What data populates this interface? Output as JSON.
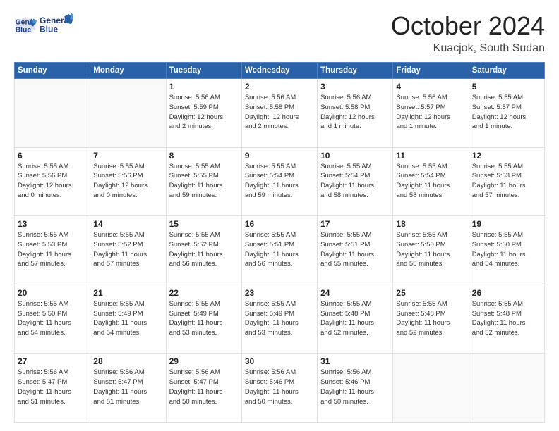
{
  "header": {
    "logo_line1": "General",
    "logo_line2": "Blue",
    "month": "October 2024",
    "location": "Kuacjok, South Sudan"
  },
  "weekdays": [
    "Sunday",
    "Monday",
    "Tuesday",
    "Wednesday",
    "Thursday",
    "Friday",
    "Saturday"
  ],
  "weeks": [
    [
      {
        "day": "",
        "info": ""
      },
      {
        "day": "",
        "info": ""
      },
      {
        "day": "1",
        "info": "Sunrise: 5:56 AM\nSunset: 5:59 PM\nDaylight: 12 hours\nand 2 minutes."
      },
      {
        "day": "2",
        "info": "Sunrise: 5:56 AM\nSunset: 5:58 PM\nDaylight: 12 hours\nand 2 minutes."
      },
      {
        "day": "3",
        "info": "Sunrise: 5:56 AM\nSunset: 5:58 PM\nDaylight: 12 hours\nand 1 minute."
      },
      {
        "day": "4",
        "info": "Sunrise: 5:56 AM\nSunset: 5:57 PM\nDaylight: 12 hours\nand 1 minute."
      },
      {
        "day": "5",
        "info": "Sunrise: 5:55 AM\nSunset: 5:57 PM\nDaylight: 12 hours\nand 1 minute."
      }
    ],
    [
      {
        "day": "6",
        "info": "Sunrise: 5:55 AM\nSunset: 5:56 PM\nDaylight: 12 hours\nand 0 minutes."
      },
      {
        "day": "7",
        "info": "Sunrise: 5:55 AM\nSunset: 5:56 PM\nDaylight: 12 hours\nand 0 minutes."
      },
      {
        "day": "8",
        "info": "Sunrise: 5:55 AM\nSunset: 5:55 PM\nDaylight: 11 hours\nand 59 minutes."
      },
      {
        "day": "9",
        "info": "Sunrise: 5:55 AM\nSunset: 5:54 PM\nDaylight: 11 hours\nand 59 minutes."
      },
      {
        "day": "10",
        "info": "Sunrise: 5:55 AM\nSunset: 5:54 PM\nDaylight: 11 hours\nand 58 minutes."
      },
      {
        "day": "11",
        "info": "Sunrise: 5:55 AM\nSunset: 5:54 PM\nDaylight: 11 hours\nand 58 minutes."
      },
      {
        "day": "12",
        "info": "Sunrise: 5:55 AM\nSunset: 5:53 PM\nDaylight: 11 hours\nand 57 minutes."
      }
    ],
    [
      {
        "day": "13",
        "info": "Sunrise: 5:55 AM\nSunset: 5:53 PM\nDaylight: 11 hours\nand 57 minutes."
      },
      {
        "day": "14",
        "info": "Sunrise: 5:55 AM\nSunset: 5:52 PM\nDaylight: 11 hours\nand 57 minutes."
      },
      {
        "day": "15",
        "info": "Sunrise: 5:55 AM\nSunset: 5:52 PM\nDaylight: 11 hours\nand 56 minutes."
      },
      {
        "day": "16",
        "info": "Sunrise: 5:55 AM\nSunset: 5:51 PM\nDaylight: 11 hours\nand 56 minutes."
      },
      {
        "day": "17",
        "info": "Sunrise: 5:55 AM\nSunset: 5:51 PM\nDaylight: 11 hours\nand 55 minutes."
      },
      {
        "day": "18",
        "info": "Sunrise: 5:55 AM\nSunset: 5:50 PM\nDaylight: 11 hours\nand 55 minutes."
      },
      {
        "day": "19",
        "info": "Sunrise: 5:55 AM\nSunset: 5:50 PM\nDaylight: 11 hours\nand 54 minutes."
      }
    ],
    [
      {
        "day": "20",
        "info": "Sunrise: 5:55 AM\nSunset: 5:50 PM\nDaylight: 11 hours\nand 54 minutes."
      },
      {
        "day": "21",
        "info": "Sunrise: 5:55 AM\nSunset: 5:49 PM\nDaylight: 11 hours\nand 54 minutes."
      },
      {
        "day": "22",
        "info": "Sunrise: 5:55 AM\nSunset: 5:49 PM\nDaylight: 11 hours\nand 53 minutes."
      },
      {
        "day": "23",
        "info": "Sunrise: 5:55 AM\nSunset: 5:49 PM\nDaylight: 11 hours\nand 53 minutes."
      },
      {
        "day": "24",
        "info": "Sunrise: 5:55 AM\nSunset: 5:48 PM\nDaylight: 11 hours\nand 52 minutes."
      },
      {
        "day": "25",
        "info": "Sunrise: 5:55 AM\nSunset: 5:48 PM\nDaylight: 11 hours\nand 52 minutes."
      },
      {
        "day": "26",
        "info": "Sunrise: 5:55 AM\nSunset: 5:48 PM\nDaylight: 11 hours\nand 52 minutes."
      }
    ],
    [
      {
        "day": "27",
        "info": "Sunrise: 5:56 AM\nSunset: 5:47 PM\nDaylight: 11 hours\nand 51 minutes."
      },
      {
        "day": "28",
        "info": "Sunrise: 5:56 AM\nSunset: 5:47 PM\nDaylight: 11 hours\nand 51 minutes."
      },
      {
        "day": "29",
        "info": "Sunrise: 5:56 AM\nSunset: 5:47 PM\nDaylight: 11 hours\nand 50 minutes."
      },
      {
        "day": "30",
        "info": "Sunrise: 5:56 AM\nSunset: 5:46 PM\nDaylight: 11 hours\nand 50 minutes."
      },
      {
        "day": "31",
        "info": "Sunrise: 5:56 AM\nSunset: 5:46 PM\nDaylight: 11 hours\nand 50 minutes."
      },
      {
        "day": "",
        "info": ""
      },
      {
        "day": "",
        "info": ""
      }
    ]
  ]
}
